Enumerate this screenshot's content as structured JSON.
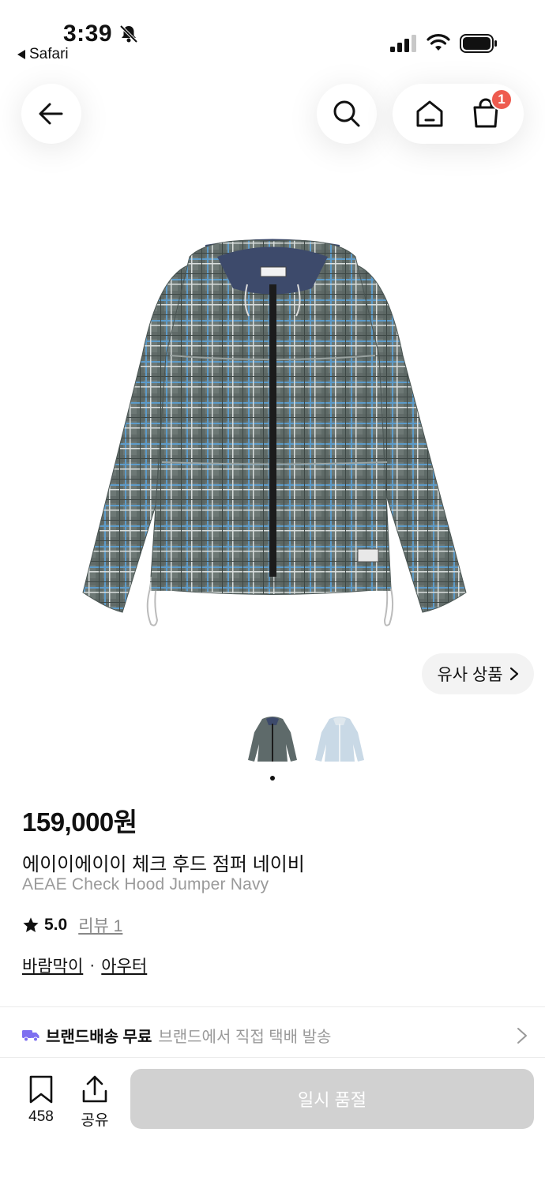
{
  "status_bar": {
    "time": "3:39",
    "back_app": "Safari"
  },
  "nav": {
    "cart_count": "1"
  },
  "similar_products": {
    "label": "유사 상품"
  },
  "product": {
    "price": "159,000원",
    "name_ko": "에이이에이이 체크 후드 점퍼 네이비",
    "name_en": "AEAE Check Hood Jumper Navy",
    "rating": "5.0",
    "review_label": "리뷰 1",
    "categories": [
      "바람막이",
      "아우터"
    ],
    "category_separator": "·"
  },
  "shipping": {
    "title": "브랜드배송 무료",
    "description": "브랜드에서 직접 택배 발송"
  },
  "bottom_bar": {
    "save_count": "458",
    "share_label": "공유",
    "buy_label": "일시 품절"
  },
  "colors": {
    "badge": "#ee5b4f",
    "shipping_truck": "#7d6ff0",
    "disabled_button": "#d1d1d1"
  }
}
